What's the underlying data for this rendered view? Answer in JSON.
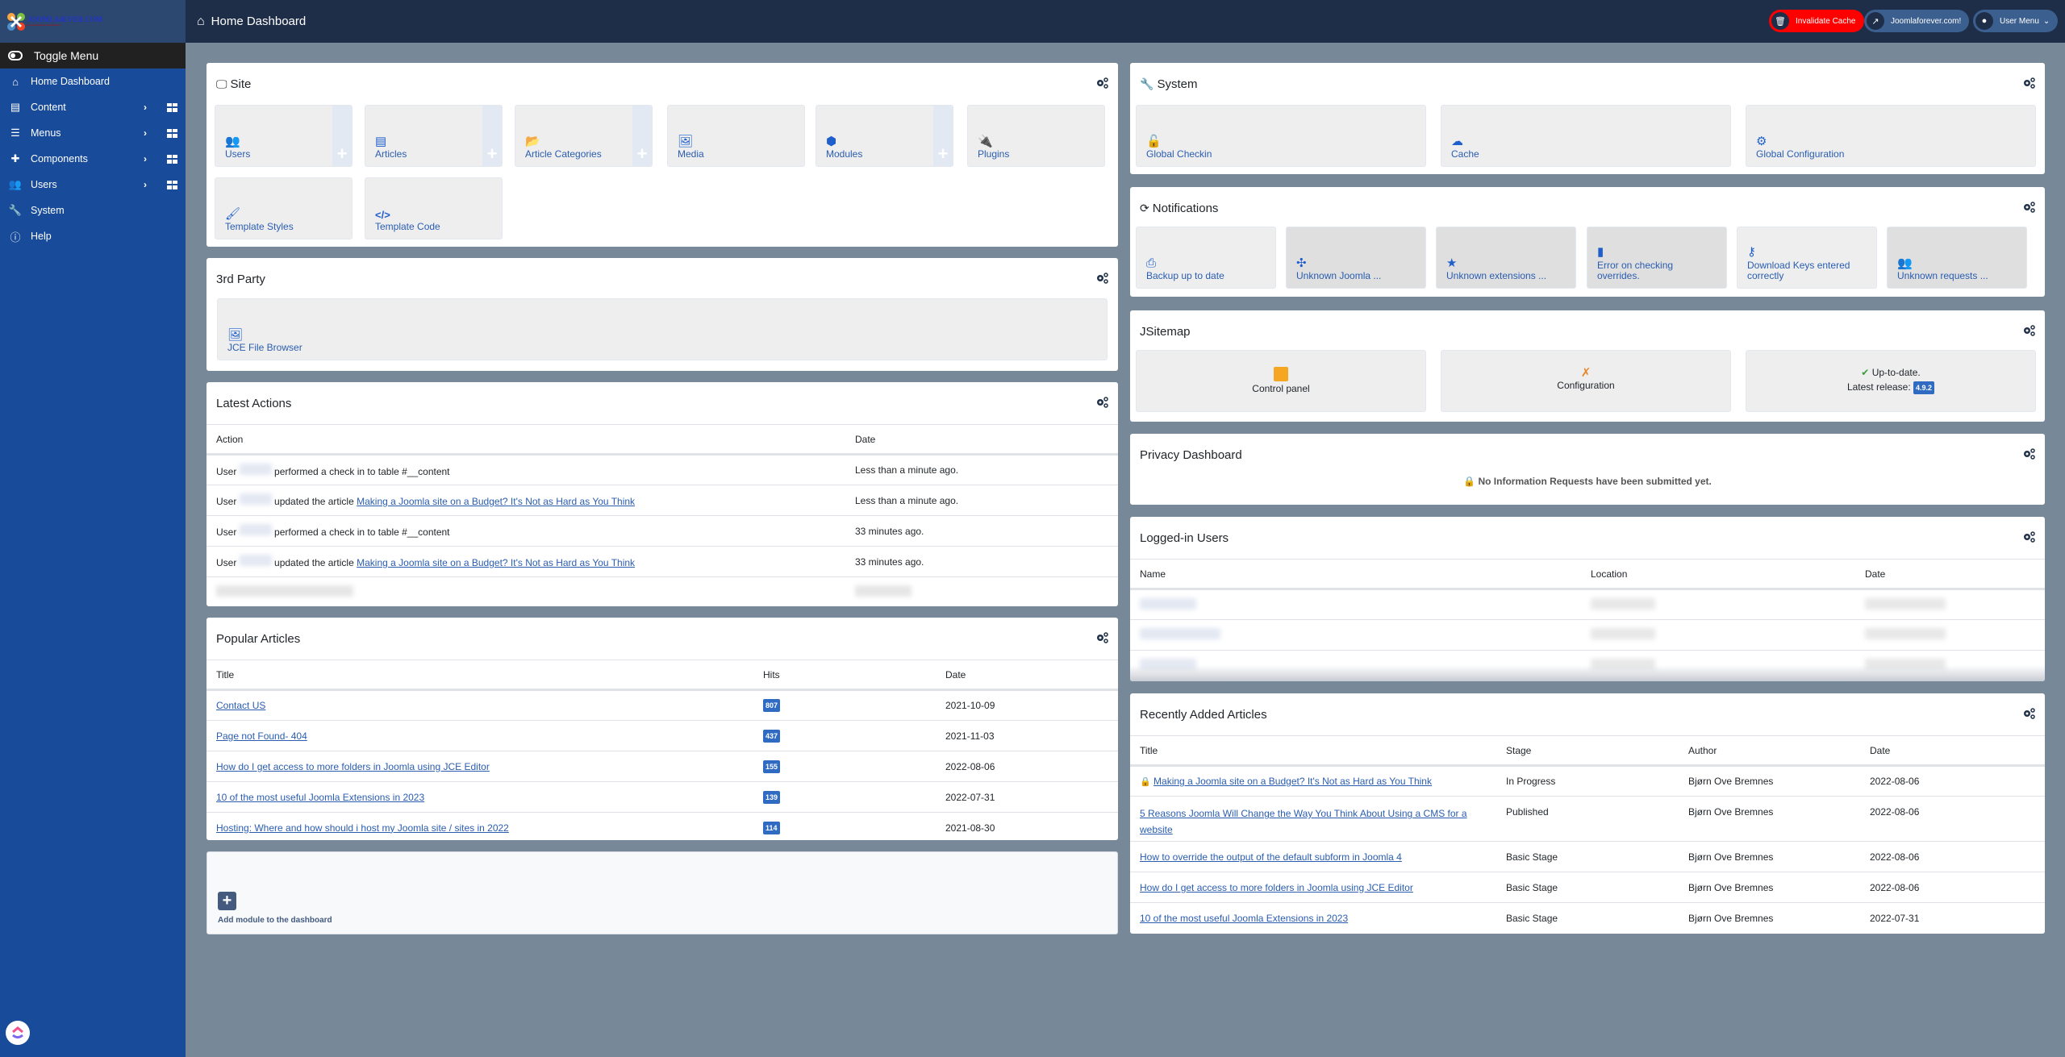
{
  "sidebar": {
    "logo_text": "JOOMLA4EVER.COM",
    "logo_sub": "Your independent Joomla friend",
    "toggle_label": "Toggle Menu",
    "items": [
      {
        "label": "Home Dashboard",
        "icon": "home-icon"
      },
      {
        "label": "Content",
        "icon": "file-icon",
        "has_submenu": true
      },
      {
        "label": "Menus",
        "icon": "list-icon",
        "has_submenu": true
      },
      {
        "label": "Components",
        "icon": "puzzle-icon",
        "has_submenu": true
      },
      {
        "label": "Users",
        "icon": "users-icon",
        "has_submenu": true
      },
      {
        "label": "System",
        "icon": "wrench-icon"
      },
      {
        "label": "Help",
        "icon": "info-icon"
      }
    ]
  },
  "header": {
    "title": "Home Dashboard",
    "buttons": {
      "invalidate_cache": "Invalidate Cache",
      "site_link": "Joomlaforever.com!",
      "user_menu": "User Menu"
    },
    "colors": {
      "invalidate": "#ff0000",
      "pill": "#3b5f8e",
      "bar": "#1f2e48"
    }
  },
  "site": {
    "title": "Site",
    "tiles": [
      {
        "label": "Users",
        "icon": "users-icon",
        "add": true
      },
      {
        "label": "Articles",
        "icon": "file-icon",
        "add": true
      },
      {
        "label": "Article Categories",
        "icon": "folder-open-icon",
        "add": true
      },
      {
        "label": "Media",
        "icon": "image-icon",
        "add": false
      },
      {
        "label": "Modules",
        "icon": "cube-icon",
        "add": true
      },
      {
        "label": "Plugins",
        "icon": "plug-icon",
        "add": false
      },
      {
        "label": "Template Styles",
        "icon": "paint-brush-icon",
        "add": false
      },
      {
        "label": "Template Code",
        "icon": "code-icon",
        "add": false
      }
    ]
  },
  "third_party": {
    "title": "3rd Party",
    "tiles": [
      {
        "label": "JCE File Browser",
        "icon": "image-icon"
      }
    ]
  },
  "latest_actions": {
    "title": "Latest Actions",
    "columns": [
      "Action",
      "Date"
    ],
    "rows": [
      {
        "prefix": "User",
        "action": "performed a check in to table #__content",
        "link": "",
        "date": "Less than a minute ago."
      },
      {
        "prefix": "User",
        "action": "updated the article",
        "link": "Making a Joomla site on a Budget? It's Not as Hard as You Think",
        "date": "Less than a minute ago."
      },
      {
        "prefix": "User",
        "action": "performed a check in to table #__content",
        "link": "",
        "date": "33 minutes ago."
      },
      {
        "prefix": "User",
        "action": "updated the article",
        "link": "Making a Joomla site on a Budget? It's Not as Hard as You Think",
        "date": "33 minutes ago."
      }
    ]
  },
  "popular_articles": {
    "title": "Popular Articles",
    "columns": [
      "Title",
      "Hits",
      "Date"
    ],
    "rows": [
      {
        "title": "Contact US",
        "hits": "807",
        "date": "2021-10-09"
      },
      {
        "title": "Page not Found- 404",
        "hits": "437",
        "date": "2021-11-03"
      },
      {
        "title": "How do I get access to more folders in Joomla using JCE Editor",
        "hits": "155",
        "date": "2022-08-06"
      },
      {
        "title": "10 of the most useful Joomla Extensions in 2023",
        "hits": "139",
        "date": "2022-07-31"
      },
      {
        "title": "Hosting: Where and how should i host my Joomla site / sites in 2022",
        "hits": "114",
        "date": "2021-08-30"
      }
    ]
  },
  "add_module": {
    "label": "Add module to the dashboard"
  },
  "system": {
    "title": "System",
    "tiles": [
      {
        "label": "Global Checkin",
        "icon": "unlock-icon"
      },
      {
        "label": "Cache",
        "icon": "cloud-icon"
      },
      {
        "label": "Global Configuration",
        "icon": "cog-icon"
      }
    ]
  },
  "notifications": {
    "title": "Notifications",
    "tiles": [
      {
        "label": "Backup up to date",
        "icon": "backup-icon",
        "muted": false
      },
      {
        "label": "Unknown Joomla ...",
        "icon": "joomla-icon",
        "muted": true
      },
      {
        "label": "Unknown extensions ...",
        "icon": "star-icon",
        "muted": true
      },
      {
        "label": "Error on checking overrides.",
        "icon": "file-icon",
        "muted": true
      },
      {
        "label": "Download Keys entered correctly",
        "icon": "key-icon",
        "muted": false
      },
      {
        "label": "Unknown requests ...",
        "icon": "users-icon",
        "muted": true
      }
    ]
  },
  "jsitemap": {
    "title": "JSitemap",
    "control_panel": "Control panel",
    "configuration": "Configuration",
    "status": "Up-to-date.",
    "latest_release_label": "Latest release:",
    "latest_release": "4.9.2"
  },
  "privacy": {
    "title": "Privacy Dashboard",
    "message": "No Information Requests have been submitted yet."
  },
  "logged_in": {
    "title": "Logged-in Users",
    "columns": [
      "Name",
      "Location",
      "Date"
    ]
  },
  "recent_articles": {
    "title": "Recently Added Articles",
    "columns": [
      "Title",
      "Stage",
      "Author",
      "Date"
    ],
    "rows": [
      {
        "title": "Making a Joomla site on a Budget? It's Not as Hard as You Think",
        "stage": "In Progress",
        "author": "Bjørn Ove Bremnes",
        "date": "2022-08-06",
        "locked": true
      },
      {
        "title": "5 Reasons Joomla Will Change the Way You Think About Using a CMS for a website",
        "stage": "Published",
        "author": "Bjørn Ove Bremnes",
        "date": "2022-08-06",
        "locked": false
      },
      {
        "title": "How to override the output of the default subform in Joomla 4",
        "stage": "Basic Stage",
        "author": "Bjørn Ove Bremnes",
        "date": "2022-08-06",
        "locked": false
      },
      {
        "title": "How do I get access to more folders in Joomla using JCE Editor",
        "stage": "Basic Stage",
        "author": "Bjørn Ove Bremnes",
        "date": "2022-08-06",
        "locked": false
      },
      {
        "title": "10 of the most useful Joomla Extensions in 2023",
        "stage": "Basic Stage",
        "author": "Bjørn Ove Bremnes",
        "date": "2022-07-31",
        "locked": false
      }
    ]
  }
}
